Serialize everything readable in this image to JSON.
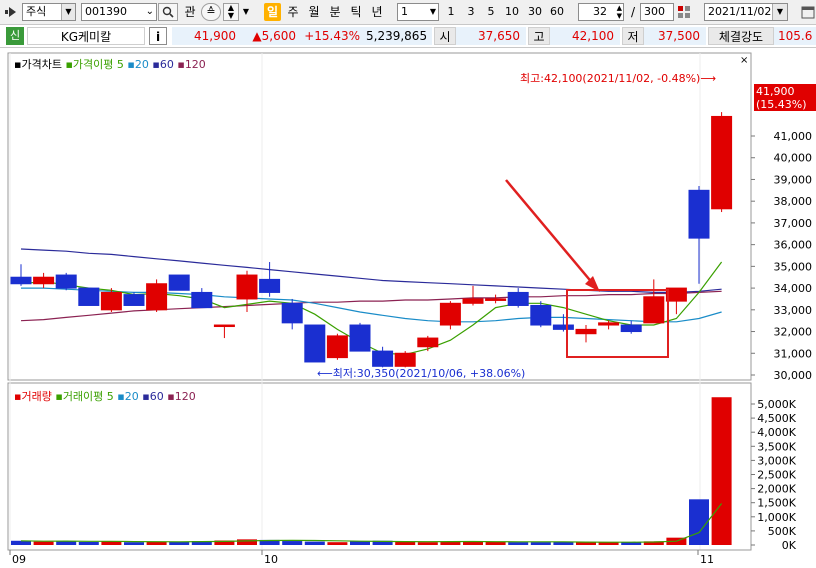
{
  "toolbar": {
    "market_label": "주식",
    "code_value": "001390",
    "search_icon": "search-icon",
    "btn_kwan": "관",
    "period_buttons": [
      "일",
      "주",
      "월",
      "분",
      "틱",
      "년"
    ],
    "interval_value": "1",
    "count_buttons": [
      "1",
      "3",
      "5",
      "10",
      "30",
      "60"
    ],
    "display_count": "32",
    "separator": "/",
    "total_count": "300",
    "date_value": "2021/11/02"
  },
  "quote": {
    "badge": "신",
    "name": "KG케미칼",
    "info_button": "i",
    "price": "41,900",
    "change": "▲5,600",
    "change_pct": "+15.43%",
    "volume": "5,239,865",
    "open_label": "시",
    "open": "37,650",
    "high_label": "고",
    "high": "42,100",
    "low_label": "저",
    "low": "37,500",
    "strength_label": "체결강도",
    "strength": "105.6"
  },
  "price_panel": {
    "legend_title": "가격차트",
    "legend_ma": "가격이평 5",
    "legend_ma20": "20",
    "legend_ma60": "60",
    "legend_ma120": "120",
    "high_note": "최고:42,100(2021/11/02, -0.48%)⟶",
    "low_note": "⟵최저:30,350(2021/10/06, +38.06%)",
    "last_price_tag": "41,900",
    "last_pct_tag": "(15.43%)",
    "y_ticks": [
      "41,000",
      "40,000",
      "39,000",
      "38,000",
      "37,000",
      "36,000",
      "35,000",
      "34,000",
      "33,000",
      "32,000",
      "31,000",
      "30,000"
    ]
  },
  "volume_panel": {
    "legend_title": "거래량",
    "legend_ma": "거래이평 5",
    "legend_ma20": "20",
    "legend_ma60": "60",
    "legend_ma120": "120",
    "y_ticks": [
      "5,000K",
      "4,500K",
      "4,000K",
      "3,500K",
      "3,000K",
      "2,500K",
      "2,000K",
      "1,500K",
      "1,000K",
      "500K",
      "0K"
    ]
  },
  "x_axis": {
    "labels": [
      "09",
      "10",
      "11"
    ]
  },
  "colors": {
    "up": "#e00000",
    "down": "#1a2fd0",
    "ma5": "#3aa000",
    "ma20": "#1a8cc8",
    "ma60": "#2b2b9a",
    "ma120": "#8b2252",
    "annotation": "#e02020"
  },
  "chart_data": {
    "type": "candlestick",
    "title": "가격차트",
    "ylim": [
      30000,
      42100
    ],
    "candles": [
      {
        "o": 34500,
        "h": 35100,
        "l": 34100,
        "c": 34200
      },
      {
        "o": 34200,
        "h": 34700,
        "l": 34000,
        "c": 34500
      },
      {
        "o": 34600,
        "h": 34700,
        "l": 33900,
        "c": 34000
      },
      {
        "o": 34000,
        "h": 34000,
        "l": 33200,
        "c": 33200
      },
      {
        "o": 33000,
        "h": 34000,
        "l": 32900,
        "c": 33800
      },
      {
        "o": 33700,
        "h": 33800,
        "l": 33200,
        "c": 33200
      },
      {
        "o": 33000,
        "h": 34400,
        "l": 32900,
        "c": 34200
      },
      {
        "o": 34600,
        "h": 34600,
        "l": 33900,
        "c": 33900
      },
      {
        "o": 33800,
        "h": 34000,
        "l": 33100,
        "c": 33100
      },
      {
        "o": 32300,
        "h": 32300,
        "l": 31700,
        "c": 32300
      },
      {
        "o": 33500,
        "h": 34800,
        "l": 32900,
        "c": 34600
      },
      {
        "o": 34400,
        "h": 35200,
        "l": 33600,
        "c": 33800
      },
      {
        "o": 33300,
        "h": 33500,
        "l": 32100,
        "c": 32400
      },
      {
        "o": 32300,
        "h": 32300,
        "l": 30600,
        "c": 30600
      },
      {
        "o": 30800,
        "h": 31900,
        "l": 30700,
        "c": 31800
      },
      {
        "o": 32300,
        "h": 32400,
        "l": 31100,
        "c": 31100
      },
      {
        "o": 31100,
        "h": 31300,
        "l": 30350,
        "c": 30400
      },
      {
        "o": 30400,
        "h": 31100,
        "l": 30350,
        "c": 31000
      },
      {
        "o": 31300,
        "h": 31800,
        "l": 31100,
        "c": 31700
      },
      {
        "o": 32300,
        "h": 33400,
        "l": 32100,
        "c": 33300
      },
      {
        "o": 33300,
        "h": 34100,
        "l": 33200,
        "c": 33500
      },
      {
        "o": 33500,
        "h": 33700,
        "l": 33300,
        "c": 33500
      },
      {
        "o": 33800,
        "h": 34000,
        "l": 33100,
        "c": 33200
      },
      {
        "o": 33200,
        "h": 33400,
        "l": 32200,
        "c": 32300
      },
      {
        "o": 32300,
        "h": 32800,
        "l": 32000,
        "c": 32100
      },
      {
        "o": 31900,
        "h": 32300,
        "l": 31500,
        "c": 32100
      },
      {
        "o": 32300,
        "h": 32500,
        "l": 32100,
        "c": 32400
      },
      {
        "o": 32300,
        "h": 32500,
        "l": 31900,
        "c": 32000
      },
      {
        "o": 32400,
        "h": 34400,
        "l": 32400,
        "c": 33600
      },
      {
        "o": 33400,
        "h": 33900,
        "l": 32800,
        "c": 34000
      },
      {
        "o": 38500,
        "h": 38700,
        "l": 34200,
        "c": 36300
      },
      {
        "o": 37650,
        "h": 42100,
        "l": 37500,
        "c": 41900
      }
    ],
    "ma5": [
      34200,
      34300,
      34150,
      34000,
      33900,
      33700,
      33750,
      33650,
      33500,
      33100,
      33250,
      33400,
      33300,
      32800,
      32100,
      31500,
      31000,
      30950,
      31200,
      31600,
      32300,
      33100,
      33300,
      33300,
      33100,
      32800,
      32500,
      32300,
      32300,
      32600,
      33800,
      35200
    ],
    "ma20": [
      34000,
      34000,
      33950,
      33900,
      33850,
      33800,
      33800,
      33750,
      33700,
      33600,
      33550,
      33500,
      33450,
      33300,
      33100,
      32900,
      32750,
      32600,
      32500,
      32450,
      32450,
      32500,
      32600,
      32650,
      32650,
      32600,
      32550,
      32500,
      32450,
      32450,
      32600,
      32900
    ],
    "ma60": [
      35800,
      35750,
      35700,
      35600,
      35550,
      35450,
      35350,
      35250,
      35150,
      35050,
      34950,
      34850,
      34750,
      34650,
      34550,
      34450,
      34350,
      34300,
      34250,
      34200,
      34150,
      34100,
      34050,
      34000,
      33950,
      33900,
      33850,
      33850,
      33800,
      33800,
      33850,
      33950
    ],
    "ma120": [
      32500,
      32550,
      32650,
      32750,
      32850,
      32950,
      33000,
      33050,
      33100,
      33150,
      33200,
      33250,
      33300,
      33350,
      33350,
      33400,
      33400,
      33450,
      33450,
      33500,
      33550,
      33550,
      33600,
      33600,
      33650,
      33650,
      33700,
      33700,
      33750,
      33750,
      33800,
      33850
    ],
    "volume": [
      150,
      120,
      140,
      110,
      130,
      100,
      110,
      120,
      140,
      160,
      200,
      180,
      140,
      120,
      100,
      130,
      150,
      110,
      100,
      120,
      140,
      110,
      100,
      100,
      110,
      100,
      90,
      100,
      130,
      260,
      1620,
      5240
    ],
    "volume_unit": "K",
    "volume_ylim": [
      0,
      5240
    ]
  }
}
